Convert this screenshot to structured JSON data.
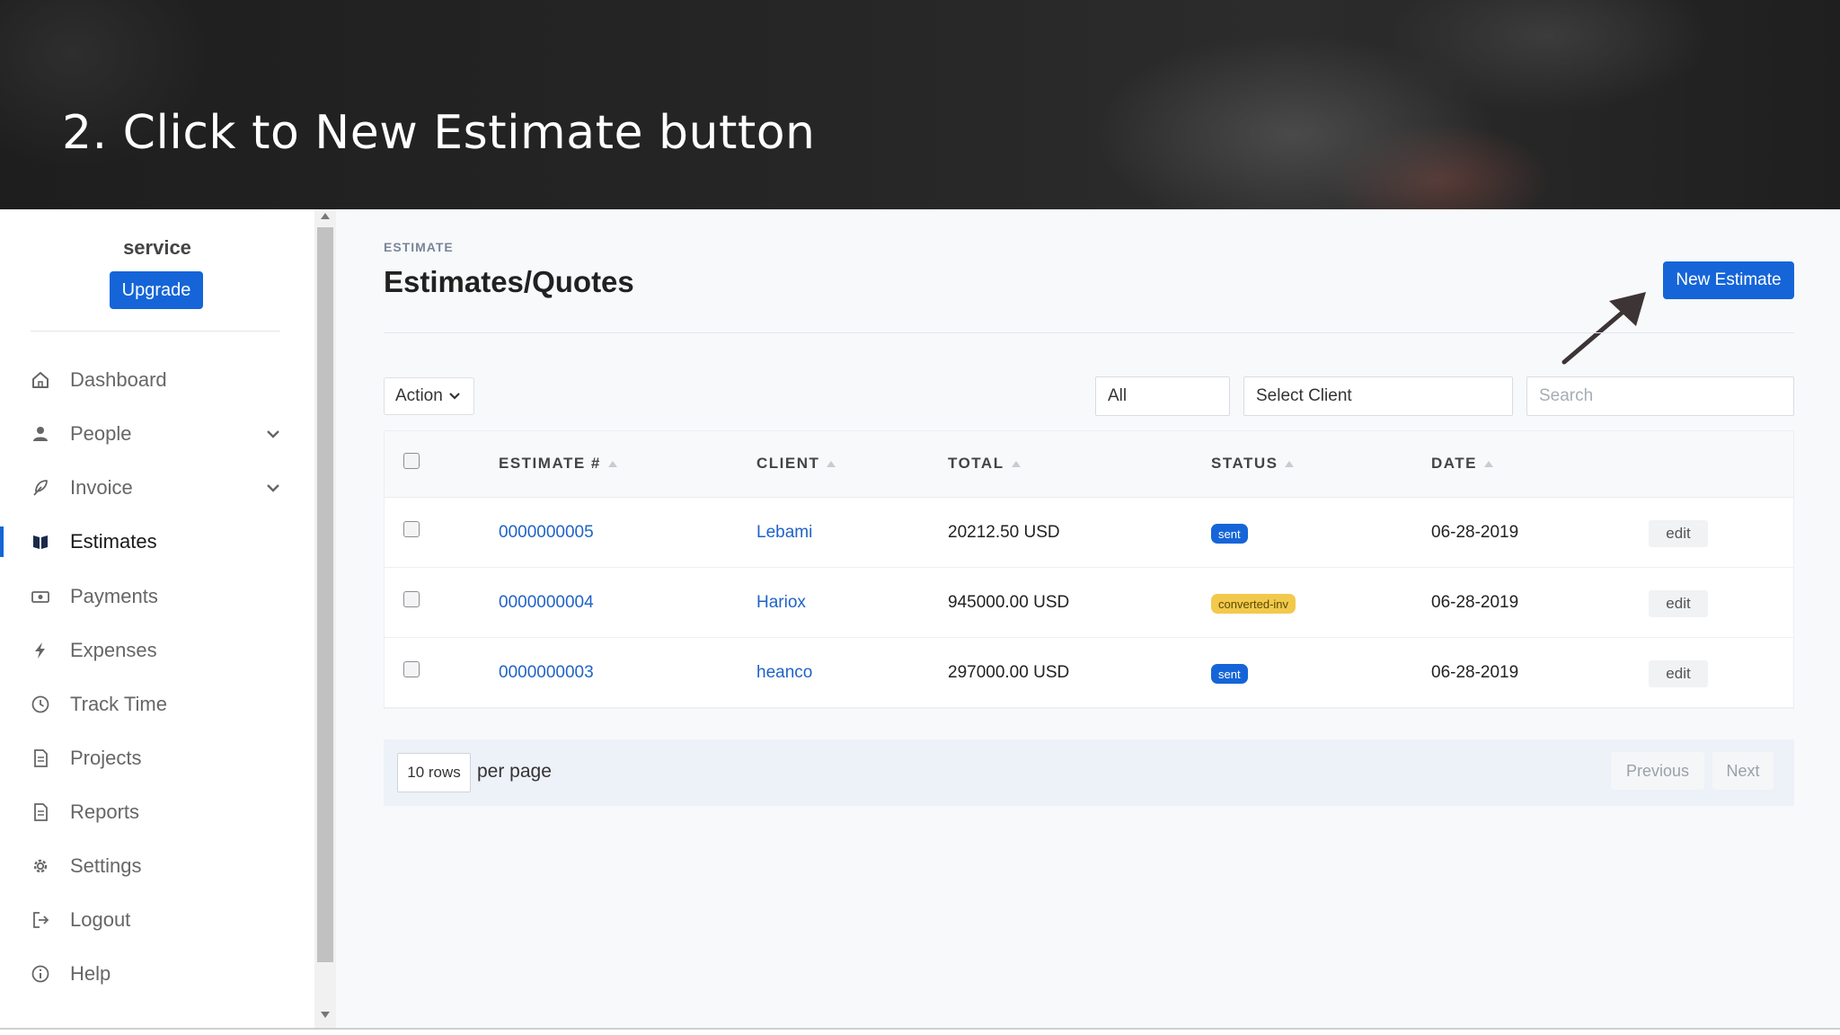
{
  "banner": {
    "title": "2. Click to New Estimate button"
  },
  "sidebar": {
    "brand": "service",
    "upgrade_label": "Upgrade",
    "items": [
      {
        "label": "Dashboard",
        "icon": "home-icon"
      },
      {
        "label": "People",
        "icon": "person-icon",
        "expandable": true
      },
      {
        "label": "Invoice",
        "icon": "feather-icon",
        "expandable": true
      },
      {
        "label": "Estimates",
        "icon": "book-icon",
        "active": true
      },
      {
        "label": "Payments",
        "icon": "money-icon"
      },
      {
        "label": "Expenses",
        "icon": "bolt-icon"
      },
      {
        "label": "Track Time",
        "icon": "clock-icon"
      },
      {
        "label": "Projects",
        "icon": "document-icon"
      },
      {
        "label": "Reports",
        "icon": "document-icon"
      },
      {
        "label": "Settings",
        "icon": "gear-icon"
      },
      {
        "label": "Logout",
        "icon": "logout-icon"
      },
      {
        "label": "Help",
        "icon": "info-icon"
      }
    ]
  },
  "main": {
    "section_label": "ESTIMATE",
    "title": "Estimates/Quotes",
    "new_button": "New Estimate",
    "toolbar": {
      "action_label": "Action",
      "status_filter": "All",
      "client_filter": "Select Client",
      "search_placeholder": "Search"
    },
    "table": {
      "columns": [
        "ESTIMATE #",
        "CLIENT",
        "TOTAL",
        "STATUS",
        "DATE"
      ],
      "rows": [
        {
          "number": "0000000005",
          "client": "Lebami",
          "total": "20212.50 USD",
          "status": "sent",
          "date": "06-28-2019",
          "edit": "edit"
        },
        {
          "number": "0000000004",
          "client": "Hariox",
          "total": "945000.00 USD",
          "status": "converted-inv",
          "date": "06-28-2019",
          "edit": "edit"
        },
        {
          "number": "0000000003",
          "client": "heanco",
          "total": "297000.00 USD",
          "status": "sent",
          "date": "06-28-2019",
          "edit": "edit"
        }
      ]
    },
    "pagination": {
      "rows_per_page": "10 rows",
      "per_page_label": "per page",
      "previous": "Previous",
      "next": "Next"
    }
  },
  "colors": {
    "accent": "#1565d8",
    "warning_badge": "#f2c94c",
    "link": "#1f63c7"
  }
}
